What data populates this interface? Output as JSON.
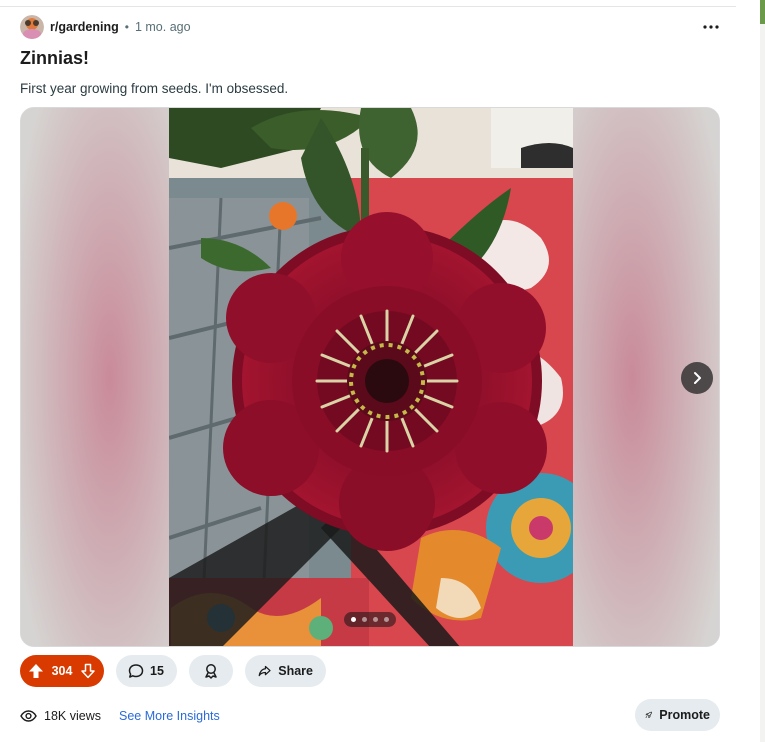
{
  "post": {
    "subreddit": "r/gardening",
    "separator": "•",
    "time_ago": "1 mo. ago",
    "title": "Zinnias!",
    "body": "First year growing from seeds. I'm obsessed."
  },
  "gallery": {
    "total_images": 4,
    "current_index": 1
  },
  "actions": {
    "vote_count": "304",
    "comment_count": "15",
    "share_label": "Share"
  },
  "footer": {
    "views": "18K views",
    "insights_label": "See More Insights",
    "promote_label": "Promote"
  },
  "colors": {
    "upvote_active": "#d93a00",
    "button_bg": "#e5ebee",
    "link": "#2b6bd8",
    "flower": "#8e0f2a"
  },
  "icons": {
    "more": "more-horizontal-icon",
    "upvote": "arrow-up-icon",
    "downvote": "arrow-down-icon",
    "comment": "comment-bubble-icon",
    "award": "award-icon",
    "share": "share-arrow-icon",
    "views": "eye-icon",
    "promote": "rocket-icon",
    "next": "chevron-right-icon"
  }
}
